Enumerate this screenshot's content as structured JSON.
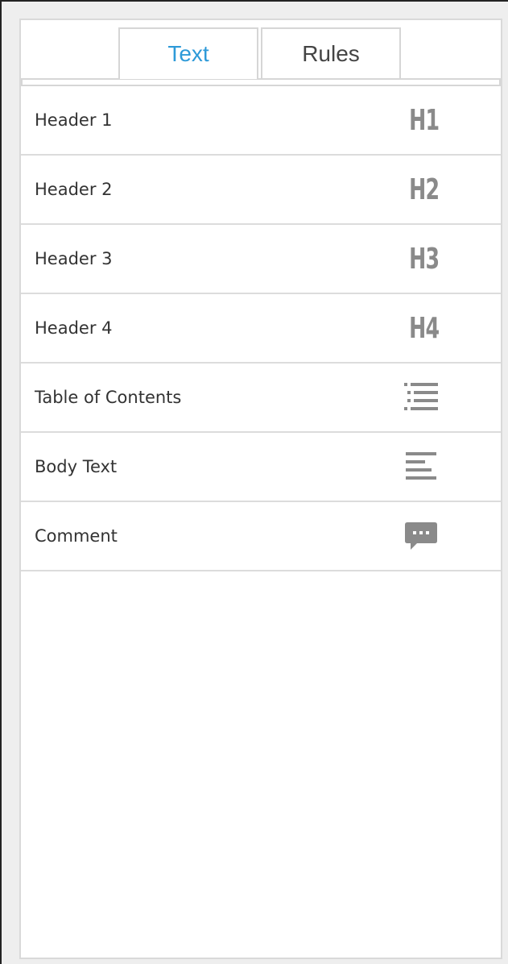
{
  "tabs": [
    {
      "label": "Text",
      "active": true
    },
    {
      "label": "Rules",
      "active": false
    }
  ],
  "items": [
    {
      "label": "Header 1",
      "icon": "h1-icon",
      "glyph": "H1"
    },
    {
      "label": "Header 2",
      "icon": "h2-icon",
      "glyph": "H2"
    },
    {
      "label": "Header 3",
      "icon": "h3-icon",
      "glyph": "H3"
    },
    {
      "label": "Header 4",
      "icon": "h4-icon",
      "glyph": "H4"
    },
    {
      "label": "Table of Contents",
      "icon": "list-icon"
    },
    {
      "label": "Body Text",
      "icon": "align-left-icon"
    },
    {
      "label": "Comment",
      "icon": "comment-icon"
    }
  ],
  "colors": {
    "accent": "#2e9ad8",
    "icon": "#8a8a8a",
    "border": "#dcdcdc"
  }
}
